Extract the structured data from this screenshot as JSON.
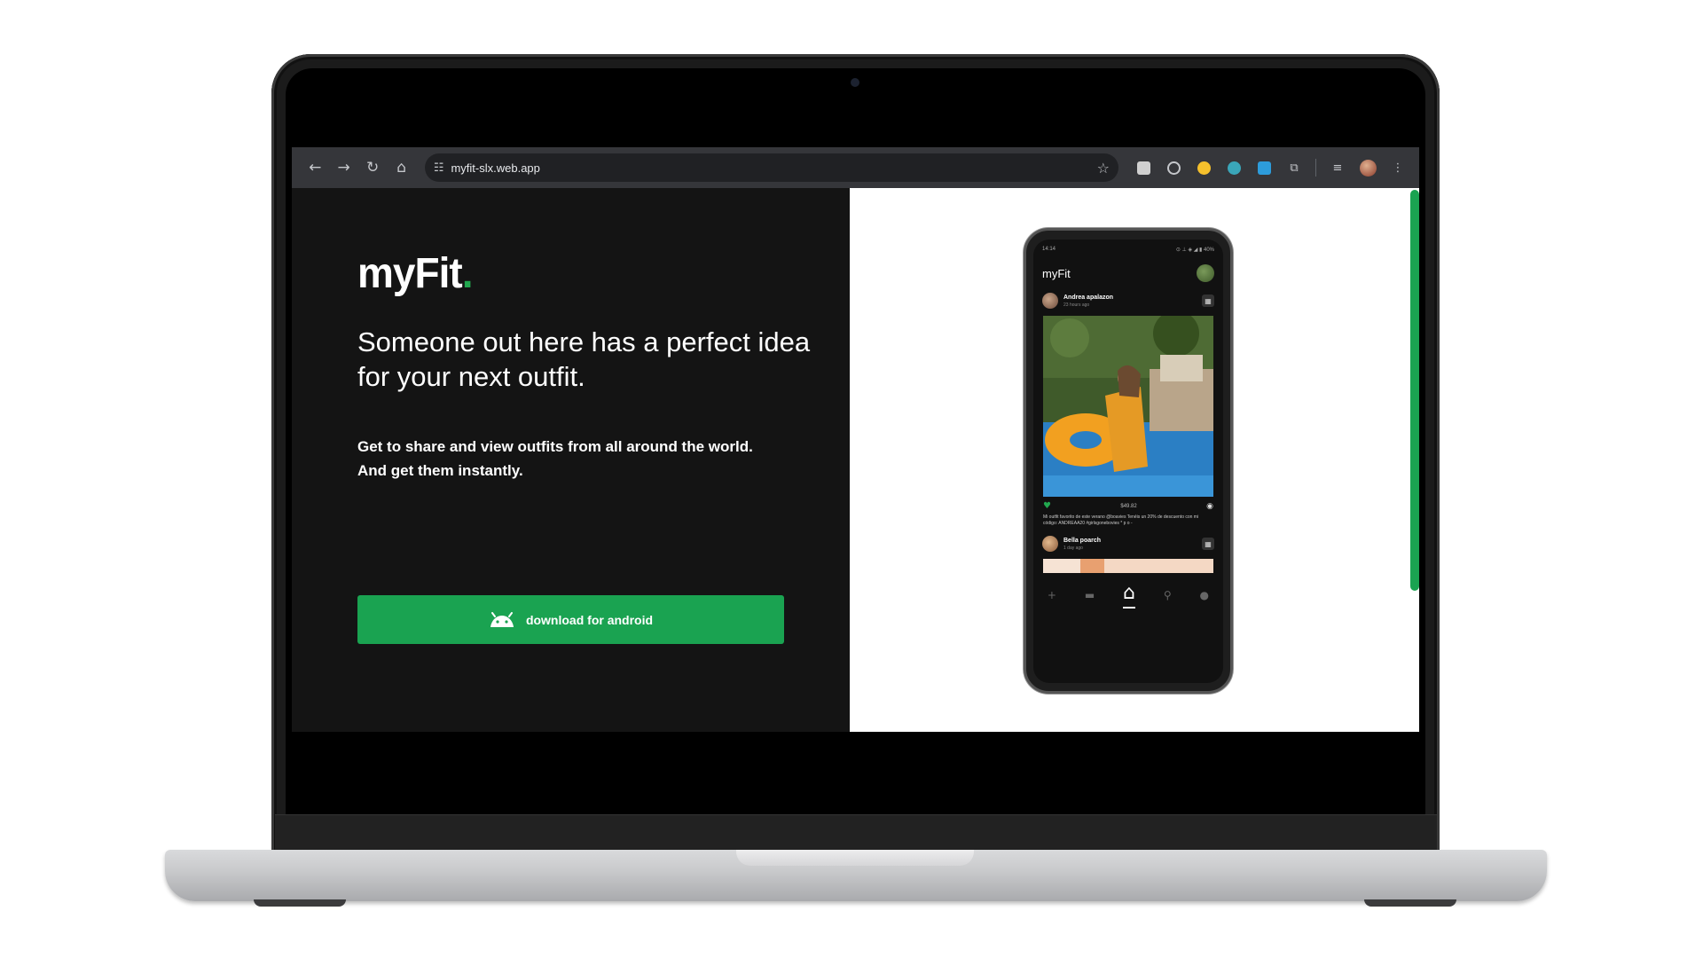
{
  "browser": {
    "url": "myfit-slx.web.app",
    "icons": [
      "back-icon",
      "forward-icon",
      "reload-icon",
      "home-icon",
      "site-settings-icon",
      "bookmark-star-icon",
      "extension-icon",
      "puzzle-icon",
      "media-icon",
      "profile-avatar",
      "menu-icon"
    ]
  },
  "landing": {
    "logo_text": "myFit",
    "logo_dot": ".",
    "headline": "Someone out here has a perfect idea for your next outfit.",
    "subtext_line1": "Get to share and view outfits from all around the world.",
    "subtext_line2": "And get them instantly.",
    "download_label": "download for android",
    "accent_color": "#1aa351"
  },
  "phone": {
    "status_time": "14:14",
    "status_icons": "⊙ ⊥ ◈ ◢ ▮ 40%",
    "app_name": "myFit",
    "post1": {
      "user": "Andrea apalazon",
      "time": "23 hours ago",
      "price": "$49.82",
      "caption": "Mi outfit favorito de este verano @boavies Tenéis un 20% de descuento con mi código: ANDREAA20 #girlsgonebovies * p o -"
    },
    "post2": {
      "user": "Bella poarch",
      "time": "1 day ago"
    }
  }
}
